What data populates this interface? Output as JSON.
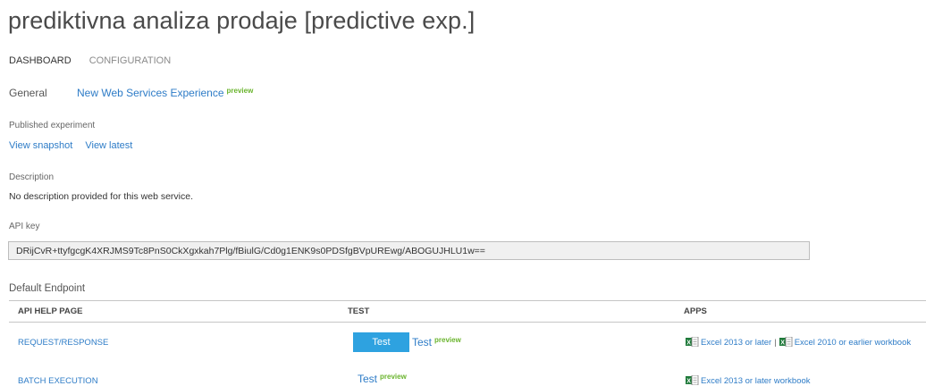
{
  "page_title": "prediktivna analiza prodaje [predictive exp.]",
  "tabs": {
    "dashboard": "DASHBOARD",
    "configuration": "CONFIGURATION"
  },
  "general": {
    "label": "General",
    "link": "New Web Services Experience",
    "badge": "preview"
  },
  "published": {
    "label": "Published experiment",
    "view_snapshot": "View snapshot",
    "view_latest": "View latest"
  },
  "description": {
    "label": "Description",
    "text": "No description provided for this web service."
  },
  "api_key": {
    "label": "API key",
    "value": "DRijCvR+ttyfgcgK4XRJMS9Tc8PnS0CkXgxkah7Plg/fBiulG/Cd0g1ENK9s0PDSfgBVpUREwg/ABOGUJHLU1w=="
  },
  "endpoint": {
    "label": "Default Endpoint",
    "columns": {
      "help": "API HELP PAGE",
      "test": "TEST",
      "apps": "APPS"
    },
    "rows": [
      {
        "name": "REQUEST/RESPONSE",
        "test_button": "Test",
        "test_link": "Test",
        "test_badge": "preview",
        "app1": "Excel 2013 or later",
        "app_sep": "|",
        "app2": "Excel 2010 or earlier workbook"
      },
      {
        "name": "BATCH EXECUTION",
        "test_link": "Test",
        "test_badge": "preview",
        "app1": "Excel 2013 or later workbook"
      }
    ]
  },
  "colors": {
    "link": "#2e7cc7",
    "preview": "#6ab42d",
    "button": "#2ea2e0",
    "excel_green": "#1f7a3a"
  }
}
